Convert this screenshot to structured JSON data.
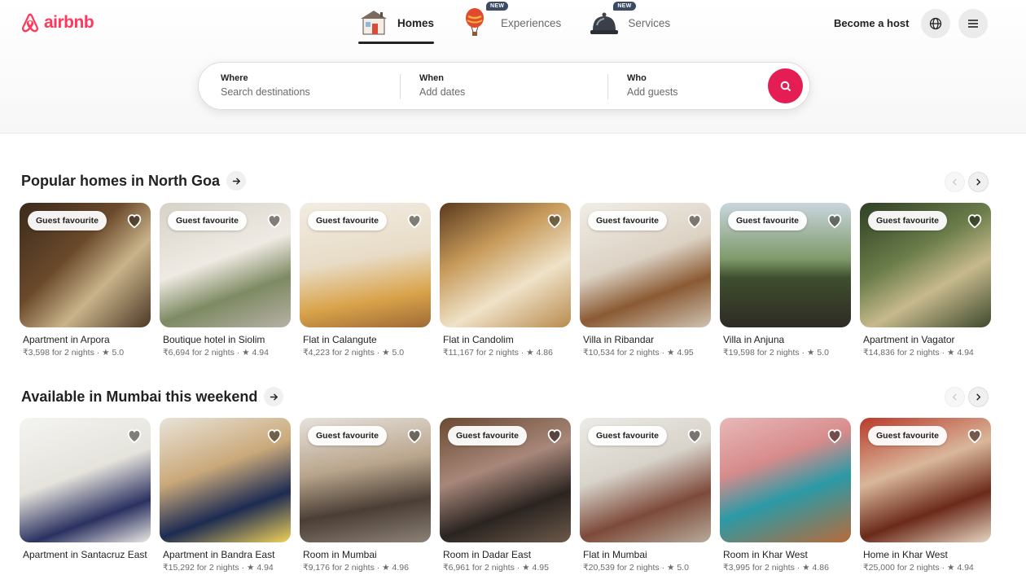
{
  "brand": {
    "name": "airbnb",
    "color": "#ff385c"
  },
  "nav": {
    "tabs": [
      {
        "label": "Homes",
        "icon": "house-icon",
        "active": true,
        "badge": ""
      },
      {
        "label": "Experiences",
        "icon": "hot-air-balloon-icon",
        "active": false,
        "badge": "NEW"
      },
      {
        "label": "Services",
        "icon": "service-bell-icon",
        "active": false,
        "badge": "NEW"
      }
    ],
    "host_label": "Become a host"
  },
  "search": {
    "where_label": "Where",
    "where_value": "Search destinations",
    "when_label": "When",
    "when_value": "Add dates",
    "who_label": "Who",
    "who_value": "Add guests",
    "button_color": "#e51d55"
  },
  "sections": [
    {
      "title": "Popular homes in North Goa",
      "listings": [
        {
          "title": "Apartment in Arpora",
          "sub": "₹3,598 for 2 nights · ★ 5.0",
          "tag": "Guest favourite"
        },
        {
          "title": "Boutique hotel in Siolim",
          "sub": "₹6,694 for 2 nights · ★ 4.94",
          "tag": "Guest favourite"
        },
        {
          "title": "Flat in Calangute",
          "sub": "₹4,223 for 2 nights · ★ 5.0",
          "tag": "Guest favourite"
        },
        {
          "title": "Flat in Candolim",
          "sub": "₹11,167 for 2 nights · ★ 4.86",
          "tag": ""
        },
        {
          "title": "Villa in Ribandar",
          "sub": "₹10,534 for 2 nights · ★ 4.95",
          "tag": "Guest favourite"
        },
        {
          "title": "Villa in Anjuna",
          "sub": "₹19,598 for 2 nights · ★ 5.0",
          "tag": "Guest favourite"
        },
        {
          "title": "Apartment in Vagator",
          "sub": "₹14,836 for 2 nights · ★ 4.94",
          "tag": "Guest favourite"
        }
      ]
    },
    {
      "title": "Available in Mumbai this weekend",
      "listings": [
        {
          "title": "Apartment in Santacruz East",
          "sub": "",
          "tag": ""
        },
        {
          "title": "Apartment in Bandra East",
          "sub": "₹15,292 for 2 nights · ★ 4.94",
          "tag": ""
        },
        {
          "title": "Room in Mumbai",
          "sub": "₹9,176 for 2 nights · ★ 4.96",
          "tag": "Guest favourite"
        },
        {
          "title": "Room in Dadar East",
          "sub": "₹6,961 for 2 nights · ★ 4.95",
          "tag": "Guest favourite"
        },
        {
          "title": "Flat in Mumbai",
          "sub": "₹20,539 for 2 nights · ★ 5.0",
          "tag": "Guest favourite"
        },
        {
          "title": "Room in Khar West",
          "sub": "₹3,995 for 2 nights · ★ 4.86",
          "tag": ""
        },
        {
          "title": "Home in Khar West",
          "sub": "₹25,000 for 2 nights · ★ 4.94",
          "tag": "Guest favourite"
        }
      ]
    }
  ]
}
